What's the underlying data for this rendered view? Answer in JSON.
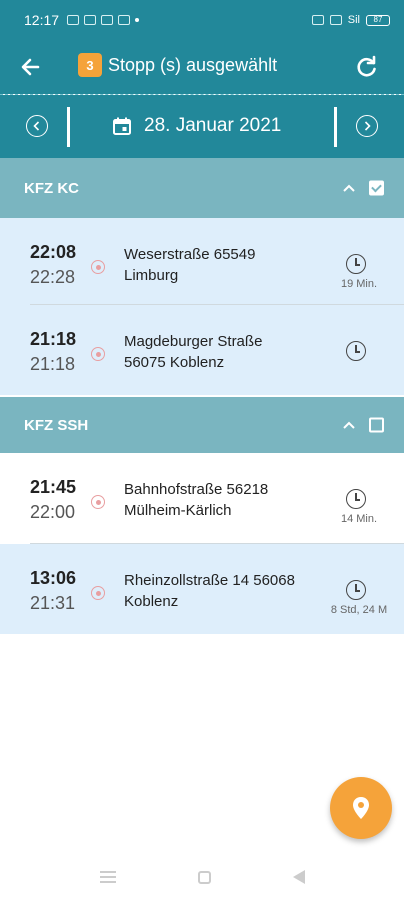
{
  "status_bar": {
    "time": "12:17",
    "right_text": "Sil",
    "battery": "87"
  },
  "header": {
    "count": "3",
    "title": "Stopp (s) ausgewählt",
    "date": "28. Januar 2021"
  },
  "groups": [
    {
      "name": "KFZ KC",
      "checked": true,
      "stops": [
        {
          "time_start": "22:08",
          "time_end": "22:28",
          "address_line1": "Weserstraße 65549",
          "address_line2": "Limburg",
          "duration": "19 Min."
        },
        {
          "time_start": "21:18",
          "time_end": "21:18",
          "address_line1": "Magdeburger Straße",
          "address_line2": "56075 Koblenz",
          "duration": ""
        }
      ]
    },
    {
      "name": "KFZ SSH",
      "checked": false,
      "stops": [
        {
          "time_start": "21:45",
          "time_end": "22:00",
          "address_line1": "Bahnhofstraße 56218",
          "address_line2": "Mülheim-Kärlich",
          "duration": "14 Min."
        },
        {
          "time_start": "13:06",
          "time_end": "21:31",
          "address_line1": "Rheinzollstraße 14 56068",
          "address_line2": "Koblenz",
          "duration": "8 Std, 24 M"
        }
      ]
    }
  ],
  "colors": {
    "primary": "#22889a",
    "group_header": "#7ab5c0",
    "selected_row": "#deeefb",
    "accent": "#f5a33a"
  },
  "icons": [
    "back-arrow-icon",
    "refresh-icon",
    "chevron-left-icon",
    "chevron-right-icon",
    "calendar-icon",
    "location-pin-icon",
    "timer-icon",
    "chevron-up-icon",
    "checkbox-icon"
  ]
}
